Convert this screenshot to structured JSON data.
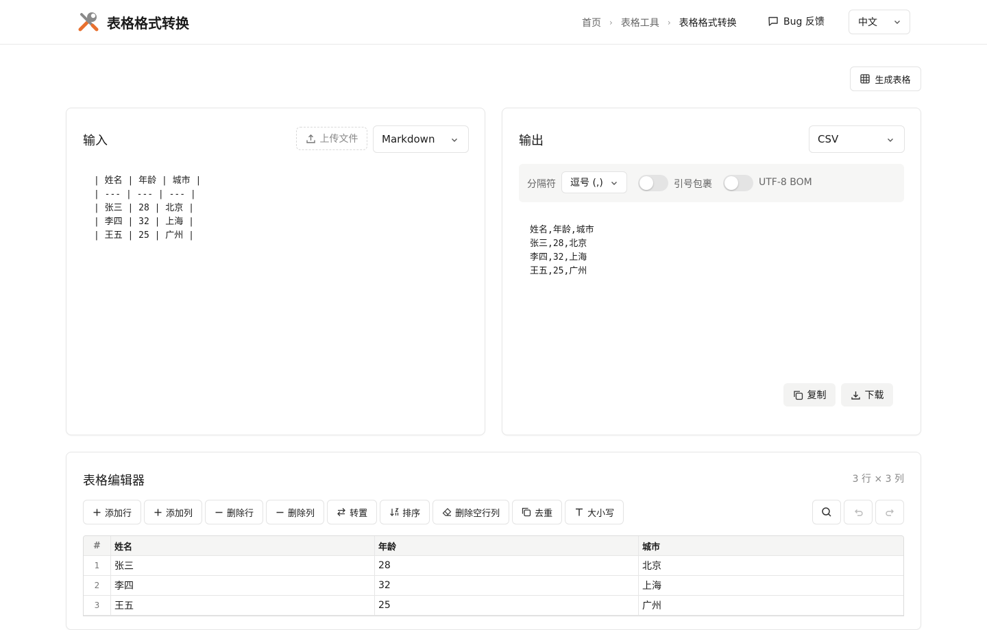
{
  "header": {
    "title": "表格格式转换",
    "breadcrumb": [
      "首页",
      "表格工具",
      "表格格式转换"
    ],
    "bug_label": "Bug 反馈",
    "language": "中文"
  },
  "generate_label": "生成表格",
  "input": {
    "title": "输入",
    "upload_label": "上传文件",
    "format": "Markdown",
    "text": "| 姓名 | 年龄 | 城市 |\n| --- | --- | --- |\n| 张三 | 28 | 北京 |\n| 李四 | 32 | 上海 |\n| 王五 | 25 | 广州 |"
  },
  "output": {
    "title": "输出",
    "format": "CSV",
    "delimiter_label": "分隔符",
    "delimiter_value": "逗号 (,)",
    "quote_label": "引号包裹",
    "bom_label": "UTF-8 BOM",
    "quote_enabled": false,
    "bom_enabled": false,
    "text": "姓名,年龄,城市\n张三,28,北京\n李四,32,上海\n王五,25,广州",
    "copy_label": "复制",
    "download_label": "下载"
  },
  "editor": {
    "title": "表格编辑器",
    "meta": "3 行 × 3 列",
    "toolbar": [
      "添加行",
      "添加列",
      "删除行",
      "删除列",
      "转置",
      "排序",
      "删除空行列",
      "去重",
      "大小写"
    ],
    "columns": [
      "姓名",
      "年龄",
      "城市"
    ],
    "rows": [
      [
        "1",
        "张三",
        "28",
        "北京"
      ],
      [
        "2",
        "李四",
        "32",
        "上海"
      ],
      [
        "3",
        "王五",
        "25",
        "广州"
      ]
    ],
    "index_header": "#"
  },
  "colors": {
    "accent": "#ea6b2d",
    "border": "#e3e3e3",
    "muted": "#888888"
  }
}
